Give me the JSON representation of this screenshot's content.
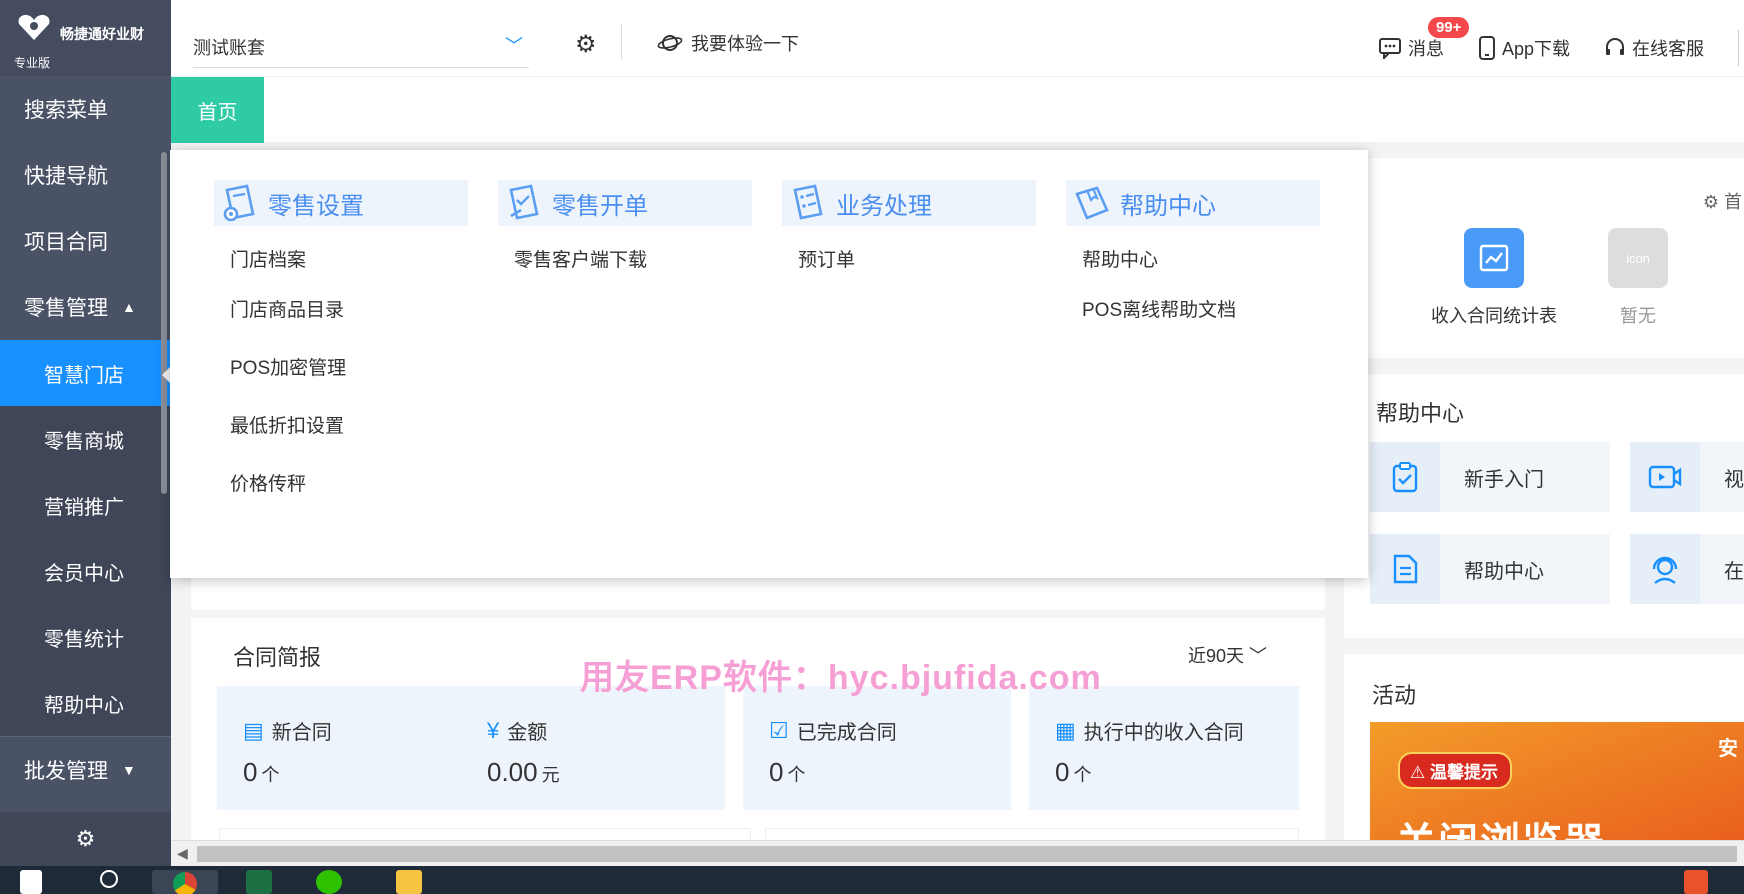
{
  "brand": {
    "name": "畅捷通好业财",
    "edition": "专业版"
  },
  "sidebar": {
    "items": [
      {
        "label": "搜索菜单"
      },
      {
        "label": "快捷导航"
      },
      {
        "label": "项目合同"
      },
      {
        "label": "零售管理",
        "caret": "▲"
      },
      {
        "label": "智慧门店"
      },
      {
        "label": "零售商城"
      },
      {
        "label": "营销推广"
      },
      {
        "label": "会员中心"
      },
      {
        "label": "零售统计"
      },
      {
        "label": "帮助中心"
      },
      {
        "label": "批发管理",
        "caret": "▼"
      }
    ]
  },
  "topbar": {
    "account": "测试账套",
    "try": "我要体验一下",
    "messages": "消息",
    "badge": "99+",
    "app": "App下载",
    "service": "在线客服"
  },
  "tabs": {
    "home": "首页"
  },
  "dropdown": {
    "columns": [
      {
        "title": "零售设置",
        "items": [
          "门店档案",
          "门店商品目录",
          "POS加密管理",
          "最低折扣设置",
          "价格传秤"
        ]
      },
      {
        "title": "零售开单",
        "items": [
          "零售客户端下载"
        ]
      },
      {
        "title": "业务处理",
        "items": [
          "预订单"
        ]
      },
      {
        "title": "帮助中心",
        "items": [
          "帮助中心",
          "POS离线帮助文档"
        ]
      }
    ]
  },
  "quick": {
    "settings": "首",
    "items": [
      {
        "label": "收入合同统计表"
      },
      {
        "label": "暂无",
        "icon_text": "icon"
      }
    ]
  },
  "help": {
    "title": "帮助中心",
    "cards": [
      {
        "label": "新手入门"
      },
      {
        "label": "视"
      },
      {
        "label": "帮助中心"
      },
      {
        "label": "在"
      }
    ]
  },
  "activity": {
    "title": "活动",
    "warn": "温馨提示",
    "big": "关闭浏览器",
    "side": "安"
  },
  "contract": {
    "title": "合同简报",
    "range": "近90天",
    "stats": [
      {
        "label": "新合同",
        "value": "0",
        "unit": "个"
      },
      {
        "label": "金额",
        "value": "0.00",
        "unit": "元"
      },
      {
        "label": "已完成合同",
        "value": "0",
        "unit": "个"
      },
      {
        "label": "执行中的收入合同",
        "value": "0",
        "unit": "个"
      }
    ]
  },
  "watermark": "用友ERP软件：hyc.bjufida.com",
  "colors": {
    "sidebar": "#4a5266",
    "active": "#1890ff",
    "tab": "#2fcba4",
    "badge": "#f5484a"
  }
}
